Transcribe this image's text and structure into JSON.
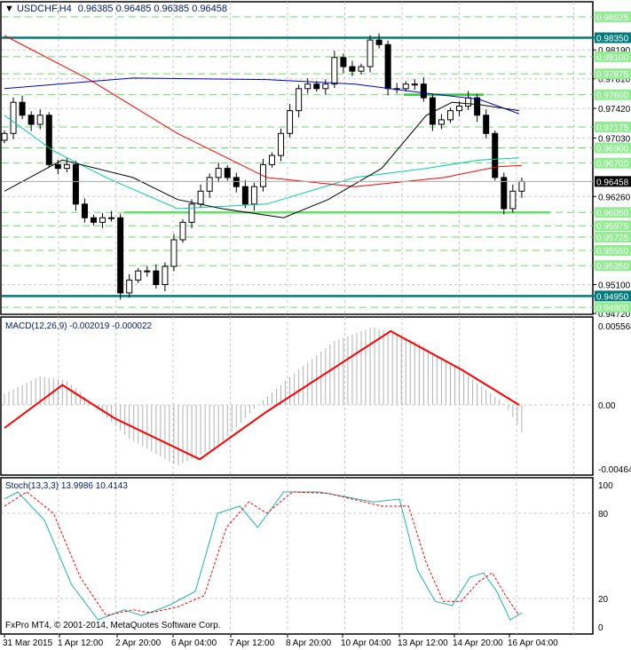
{
  "header": {
    "symbol": "USDCHF,H4",
    "ohlc": "0.96385 0.96485 0.96385 0.96458"
  },
  "macd_label": "MACD(12,26,9) -0.002019 -0.000022",
  "stoch_label": "Stoch(13,3,3) 13.9986 10.4143",
  "copyright": "FxPro MT4, © 2001-2014, MetaQuotes Software Corp.",
  "colors": {
    "teal": "#007b7b",
    "green": "#66dd66",
    "label_green": "#90ee90",
    "red": "#ff0000",
    "blue": "#0000cc",
    "sea": "#00d0a0",
    "stoch_main": "#20b2aa"
  },
  "chart_data": {
    "type": "candlestick",
    "price_range": [
      0.9472,
      0.98625
    ],
    "current_price": "0.96458",
    "price_axis_labels": [
      "0.98190",
      "0.97810",
      "0.97420",
      "0.97030",
      "0.96260",
      "0.95100",
      "0.94720"
    ],
    "green_levels": [
      "0.98625",
      "0.98100",
      "0.97875",
      "0.97600",
      "0.97175",
      "0.96900",
      "0.96700",
      "0.96050",
      "0.95875",
      "0.95725",
      "0.95550",
      "0.95350",
      "0.94800"
    ],
    "teal_levels": [
      "0.98350",
      "0.94950"
    ],
    "support_line": 0.9605,
    "resistance_segment": 0.976,
    "time_labels": [
      "31 Mar 2015",
      "1 Apr 12:00",
      "2 Apr 20:00",
      "6 Apr 04:00",
      "7 Apr 12:00",
      "8 Apr 20:00",
      "10 Apr 04:00",
      "13 Apr 12:00",
      "14 Apr 20:00",
      "16 Apr 04:00"
    ],
    "closes": [
      0.9709,
      0.975,
      0.9733,
      0.9721,
      0.9733,
      0.9668,
      0.9663,
      0.9668,
      0.9616,
      0.9598,
      0.9592,
      0.9598,
      0.9598,
      0.9499,
      0.9516,
      0.9528,
      0.9528,
      0.951,
      0.9534,
      0.9569,
      0.9592,
      0.9616,
      0.9633,
      0.9651,
      0.9663,
      0.9651,
      0.9639,
      0.9616,
      0.9639,
      0.9668,
      0.968,
      0.9709,
      0.9739,
      0.9768,
      0.9774,
      0.9768,
      0.9774,
      0.9809,
      0.9797,
      0.9791,
      0.9797,
      0.9832,
      0.9826,
      0.9768,
      0.9768,
      0.9774,
      0.9774,
      0.9756,
      0.9721,
      0.9727,
      0.9739,
      0.9745,
      0.9756,
      0.9733,
      0.9709,
      0.9651,
      0.961,
      0.9633,
      0.96458
    ],
    "first_open": 0.97,
    "ma_red": [
      [
        0,
        0.9838
      ],
      [
        9.5,
        0.978
      ],
      [
        19.4,
        0.9709
      ],
      [
        29.4,
        0.9651
      ],
      [
        39.3,
        0.9639
      ],
      [
        49.3,
        0.9651
      ],
      [
        55.2,
        0.9665
      ],
      [
        58,
        0.9667
      ]
    ],
    "ma_blue": [
      [
        0,
        0.9768
      ],
      [
        14.4,
        0.9782
      ],
      [
        29.4,
        0.978
      ],
      [
        39.3,
        0.9774
      ],
      [
        47.3,
        0.9762
      ],
      [
        53.2,
        0.9754
      ],
      [
        57.7,
        0.9735
      ]
    ],
    "ma_black": [
      [
        0,
        0.9633
      ],
      [
        6.5,
        0.9674
      ],
      [
        14.4,
        0.9651
      ],
      [
        19.4,
        0.9622
      ],
      [
        24.4,
        0.961
      ],
      [
        31.3,
        0.9598
      ],
      [
        36.3,
        0.9622
      ],
      [
        42.3,
        0.9663
      ],
      [
        47.3,
        0.9733
      ],
      [
        50.2,
        0.975
      ],
      [
        53.2,
        0.9747
      ],
      [
        57.7,
        0.9739
      ]
    ],
    "ma_sea": [
      [
        0,
        0.9733
      ],
      [
        5.5,
        0.9686
      ],
      [
        11.4,
        0.9651
      ],
      [
        19.4,
        0.961
      ],
      [
        29.4,
        0.9616
      ],
      [
        39.3,
        0.9651
      ],
      [
        47.3,
        0.9663
      ],
      [
        53.2,
        0.9674
      ],
      [
        57.7,
        0.9677
      ]
    ],
    "macd": {
      "range": [
        -0.004644,
        0.005568
      ],
      "labels": [
        "0.005568",
        "0.00",
        "-0.004644"
      ],
      "hist": [
        [
          0,
          0.0008
        ],
        [
          4,
          0.002
        ],
        [
          7,
          0.0017
        ],
        [
          10,
          0.0
        ],
        [
          14,
          -0.0025
        ],
        [
          19.4,
          -0.0045
        ],
        [
          24,
          -0.003
        ],
        [
          28.4,
          0.0
        ],
        [
          33,
          0.0025
        ],
        [
          37,
          0.0045
        ],
        [
          41.3,
          0.0055
        ],
        [
          46,
          0.0045
        ],
        [
          51,
          0.0025
        ],
        [
          56.2,
          0.0
        ],
        [
          58,
          -0.002
        ]
      ],
      "signal": [
        [
          0,
          -0.0017
        ],
        [
          6.5,
          0.0014
        ],
        [
          12.4,
          -0.001
        ],
        [
          21.9,
          -0.004
        ],
        [
          29.4,
          -0.0005
        ],
        [
          43.3,
          0.0052
        ],
        [
          51.2,
          0.0025
        ],
        [
          57.7,
          0.0
        ]
      ]
    },
    "stoch": {
      "labels": [
        "100",
        "80",
        "20",
        "0"
      ],
      "main": [
        [
          0,
          90
        ],
        [
          1.5,
          95
        ],
        [
          4.5,
          75
        ],
        [
          7.5,
          30
        ],
        [
          10.5,
          5
        ],
        [
          13.4,
          12
        ],
        [
          15.4,
          8
        ],
        [
          18.4,
          15
        ],
        [
          21.4,
          25
        ],
        [
          23.9,
          80
        ],
        [
          26.4,
          85
        ],
        [
          28.4,
          70
        ],
        [
          31.3,
          95
        ],
        [
          35.3,
          95
        ],
        [
          41.3,
          88
        ],
        [
          44.3,
          90
        ],
        [
          46.3,
          40
        ],
        [
          48.3,
          18
        ],
        [
          50.2,
          15
        ],
        [
          52.2,
          35
        ],
        [
          53.7,
          38
        ],
        [
          55.2,
          25
        ],
        [
          56.7,
          5
        ],
        [
          58,
          10
        ]
      ],
      "signal": [
        [
          0,
          85
        ],
        [
          2.5,
          95
        ],
        [
          5.5,
          80
        ],
        [
          8.5,
          35
        ],
        [
          11.4,
          8
        ],
        [
          14.4,
          12
        ],
        [
          16.4,
          10
        ],
        [
          19.4,
          14
        ],
        [
          22.4,
          22
        ],
        [
          24.9,
          70
        ],
        [
          27.4,
          88
        ],
        [
          29.4,
          80
        ],
        [
          32.3,
          95
        ],
        [
          36.3,
          94
        ],
        [
          42.3,
          85
        ],
        [
          45.3,
          85
        ],
        [
          47.3,
          45
        ],
        [
          49.2,
          18
        ],
        [
          51.2,
          18
        ],
        [
          53.2,
          32
        ],
        [
          54.7,
          38
        ],
        [
          56.2,
          22
        ],
        [
          57.7,
          8
        ]
      ]
    }
  }
}
